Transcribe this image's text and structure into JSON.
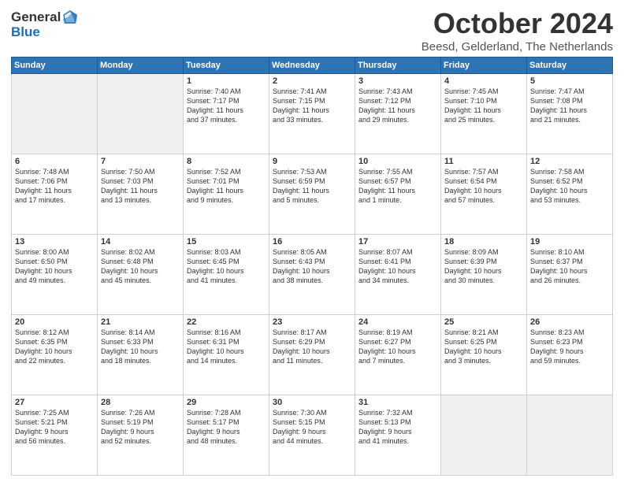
{
  "header": {
    "logo_general": "General",
    "logo_blue": "Blue",
    "title": "October 2024",
    "location": "Beesd, Gelderland, The Netherlands"
  },
  "days_of_week": [
    "Sunday",
    "Monday",
    "Tuesday",
    "Wednesday",
    "Thursday",
    "Friday",
    "Saturday"
  ],
  "weeks": [
    [
      {
        "day": "",
        "content": "",
        "empty": true
      },
      {
        "day": "",
        "content": "",
        "empty": true
      },
      {
        "day": "1",
        "content": "Sunrise: 7:40 AM\nSunset: 7:17 PM\nDaylight: 11 hours\nand 37 minutes."
      },
      {
        "day": "2",
        "content": "Sunrise: 7:41 AM\nSunset: 7:15 PM\nDaylight: 11 hours\nand 33 minutes."
      },
      {
        "day": "3",
        "content": "Sunrise: 7:43 AM\nSunset: 7:12 PM\nDaylight: 11 hours\nand 29 minutes."
      },
      {
        "day": "4",
        "content": "Sunrise: 7:45 AM\nSunset: 7:10 PM\nDaylight: 11 hours\nand 25 minutes."
      },
      {
        "day": "5",
        "content": "Sunrise: 7:47 AM\nSunset: 7:08 PM\nDaylight: 11 hours\nand 21 minutes."
      }
    ],
    [
      {
        "day": "6",
        "content": "Sunrise: 7:48 AM\nSunset: 7:06 PM\nDaylight: 11 hours\nand 17 minutes."
      },
      {
        "day": "7",
        "content": "Sunrise: 7:50 AM\nSunset: 7:03 PM\nDaylight: 11 hours\nand 13 minutes."
      },
      {
        "day": "8",
        "content": "Sunrise: 7:52 AM\nSunset: 7:01 PM\nDaylight: 11 hours\nand 9 minutes."
      },
      {
        "day": "9",
        "content": "Sunrise: 7:53 AM\nSunset: 6:59 PM\nDaylight: 11 hours\nand 5 minutes."
      },
      {
        "day": "10",
        "content": "Sunrise: 7:55 AM\nSunset: 6:57 PM\nDaylight: 11 hours\nand 1 minute."
      },
      {
        "day": "11",
        "content": "Sunrise: 7:57 AM\nSunset: 6:54 PM\nDaylight: 10 hours\nand 57 minutes."
      },
      {
        "day": "12",
        "content": "Sunrise: 7:58 AM\nSunset: 6:52 PM\nDaylight: 10 hours\nand 53 minutes."
      }
    ],
    [
      {
        "day": "13",
        "content": "Sunrise: 8:00 AM\nSunset: 6:50 PM\nDaylight: 10 hours\nand 49 minutes."
      },
      {
        "day": "14",
        "content": "Sunrise: 8:02 AM\nSunset: 6:48 PM\nDaylight: 10 hours\nand 45 minutes."
      },
      {
        "day": "15",
        "content": "Sunrise: 8:03 AM\nSunset: 6:45 PM\nDaylight: 10 hours\nand 41 minutes."
      },
      {
        "day": "16",
        "content": "Sunrise: 8:05 AM\nSunset: 6:43 PM\nDaylight: 10 hours\nand 38 minutes."
      },
      {
        "day": "17",
        "content": "Sunrise: 8:07 AM\nSunset: 6:41 PM\nDaylight: 10 hours\nand 34 minutes."
      },
      {
        "day": "18",
        "content": "Sunrise: 8:09 AM\nSunset: 6:39 PM\nDaylight: 10 hours\nand 30 minutes."
      },
      {
        "day": "19",
        "content": "Sunrise: 8:10 AM\nSunset: 6:37 PM\nDaylight: 10 hours\nand 26 minutes."
      }
    ],
    [
      {
        "day": "20",
        "content": "Sunrise: 8:12 AM\nSunset: 6:35 PM\nDaylight: 10 hours\nand 22 minutes."
      },
      {
        "day": "21",
        "content": "Sunrise: 8:14 AM\nSunset: 6:33 PM\nDaylight: 10 hours\nand 18 minutes."
      },
      {
        "day": "22",
        "content": "Sunrise: 8:16 AM\nSunset: 6:31 PM\nDaylight: 10 hours\nand 14 minutes."
      },
      {
        "day": "23",
        "content": "Sunrise: 8:17 AM\nSunset: 6:29 PM\nDaylight: 10 hours\nand 11 minutes."
      },
      {
        "day": "24",
        "content": "Sunrise: 8:19 AM\nSunset: 6:27 PM\nDaylight: 10 hours\nand 7 minutes."
      },
      {
        "day": "25",
        "content": "Sunrise: 8:21 AM\nSunset: 6:25 PM\nDaylight: 10 hours\nand 3 minutes."
      },
      {
        "day": "26",
        "content": "Sunrise: 8:23 AM\nSunset: 6:23 PM\nDaylight: 9 hours\nand 59 minutes."
      }
    ],
    [
      {
        "day": "27",
        "content": "Sunrise: 7:25 AM\nSunset: 5:21 PM\nDaylight: 9 hours\nand 56 minutes."
      },
      {
        "day": "28",
        "content": "Sunrise: 7:26 AM\nSunset: 5:19 PM\nDaylight: 9 hours\nand 52 minutes."
      },
      {
        "day": "29",
        "content": "Sunrise: 7:28 AM\nSunset: 5:17 PM\nDaylight: 9 hours\nand 48 minutes."
      },
      {
        "day": "30",
        "content": "Sunrise: 7:30 AM\nSunset: 5:15 PM\nDaylight: 9 hours\nand 44 minutes."
      },
      {
        "day": "31",
        "content": "Sunrise: 7:32 AM\nSunset: 5:13 PM\nDaylight: 9 hours\nand 41 minutes."
      },
      {
        "day": "",
        "content": "",
        "empty": true
      },
      {
        "day": "",
        "content": "",
        "empty": true
      }
    ]
  ]
}
